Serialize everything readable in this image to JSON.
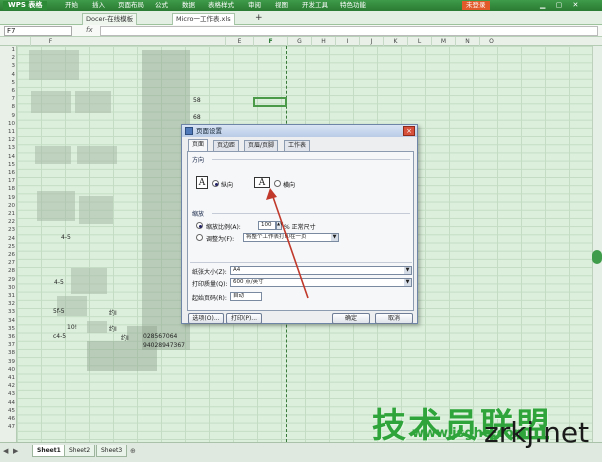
{
  "menubar": {
    "app_name": "WPS 表格",
    "items": [
      "开始",
      "插入",
      "页面布局",
      "公式",
      "数据",
      "表格样式",
      "审阅",
      "视图",
      "开发工具",
      "特色功能"
    ],
    "help_badge": "未登录"
  },
  "tabs": {
    "doc1": "Docer-在线模板",
    "doc2": "Micro一工作表.xls",
    "add": "+"
  },
  "formulabar": {
    "namebox": "F7",
    "fx": "fx"
  },
  "columns": [
    "F",
    "E",
    "F",
    "G",
    "H",
    "I",
    "J",
    "K",
    "L",
    "M",
    "N",
    "O"
  ],
  "rows": [
    "1",
    "2",
    "3",
    "4",
    "5",
    "6",
    "7",
    "8",
    "9",
    "10",
    "11",
    "12",
    "13",
    "14",
    "15",
    "16",
    "17",
    "18",
    "19",
    "20",
    "21",
    "22",
    "23",
    "24",
    "25",
    "26",
    "27",
    "28",
    "29",
    "30",
    "31",
    "32",
    "33",
    "34",
    "35",
    "36",
    "37",
    "38",
    "39",
    "40",
    "41",
    "42",
    "43",
    "44",
    "45",
    "46",
    "47"
  ],
  "cells": {
    "r1": "4-5",
    "r2": "4-5",
    "r3": "5f-5",
    "r4": "10!",
    "r5": "c4-5",
    "v1": "约I",
    "v2": "约I",
    "v3": "约I",
    "n1": "028567064",
    "n2": "94028947367",
    "n3": "58",
    "n4": "68"
  },
  "sheets": [
    "Sheet1",
    "Sheet2",
    "Sheet3"
  ],
  "dialog": {
    "title": "页面设置",
    "close": "×",
    "tabs": [
      "页面",
      "页边距",
      "页眉/页脚",
      "工作表"
    ],
    "orientation_section": "方向",
    "portrait_label": "纵向",
    "landscape_label": "横向",
    "portrait_selected": true,
    "scaling_section": "缩放",
    "scale_label": "缩放比例(A):",
    "scale_value": "100",
    "scale_suffix": "% 正常尺寸",
    "fit_label": "调整为(F):",
    "fit_value": "将整个工作表打印在一页",
    "paper_size_label": "纸张大小(Z):",
    "paper_size_value": "A4",
    "print_quality_label": "打印质量(Q):",
    "print_quality_value": "600 点/英寸",
    "first_page_label": "起始页码(R):",
    "first_page_value": "自动",
    "btn_options": "选项(O)...",
    "btn_print": "打印(P)...",
    "btn_ok": "确定",
    "btn_cancel": "取消"
  },
  "watermark": {
    "site_cn": "技术员联盟",
    "site_url": "www.jsgho.com",
    "site_zr": "zrkj.net"
  },
  "colors": {
    "accent": "#3f9c4a",
    "arrow": "#c0392b",
    "watermark": "#2ea43a"
  }
}
